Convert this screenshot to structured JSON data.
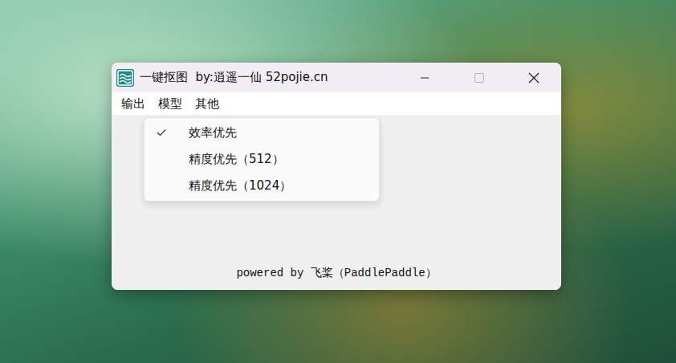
{
  "window": {
    "title": "一键抠图  by:逍遥一仙 52pojie.cn"
  },
  "menu": [
    {
      "label": "输出",
      "open": false
    },
    {
      "label": "模型",
      "open": true
    },
    {
      "label": "其他",
      "open": false
    }
  ],
  "dropdown": {
    "items": [
      {
        "label": "效率优先",
        "checked": true
      },
      {
        "label": "精度优先（512）",
        "checked": false
      },
      {
        "label": "精度优先（1024）",
        "checked": false
      }
    ]
  },
  "footer": "powered by 飞桨（PaddlePaddle）"
}
